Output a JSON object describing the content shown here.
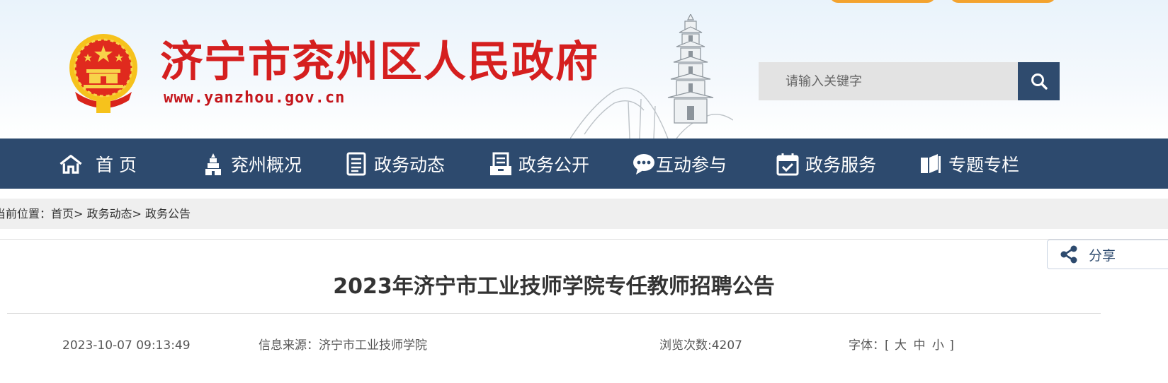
{
  "header": {
    "site_name": "济宁市兖州区人民政府",
    "site_url": "www.yanzhou.gov.cn",
    "emblem_icon": "national-emblem-icon",
    "decoration_icon": "pagoda-illustration",
    "colors": {
      "title_red": "#d51f1f",
      "tab_orange": "#f3a32f"
    }
  },
  "search": {
    "placeholder": "请输入关键字",
    "value": "",
    "button_icon": "search-icon",
    "button_color": "#2f4b6e"
  },
  "nav": {
    "background": "#2d4a6e",
    "items": [
      {
        "label": "首 页",
        "icon": "home-icon"
      },
      {
        "label": "兖州概况",
        "icon": "building-icon"
      },
      {
        "label": "政务动态",
        "icon": "document-list-icon"
      },
      {
        "label": "政务公开",
        "icon": "open-document-icon"
      },
      {
        "label": "互动参与",
        "icon": "chat-bubble-icon"
      },
      {
        "label": "政务服务",
        "icon": "calendar-check-icon"
      },
      {
        "label": "专题专栏",
        "icon": "book-icon"
      }
    ]
  },
  "breadcrumb": {
    "prefix": "当前位置：",
    "items": [
      "首页",
      "政务动态",
      "政务公告"
    ],
    "separator": ">"
  },
  "share": {
    "label": "分享",
    "icon": "share-icon"
  },
  "article": {
    "title": "2023年济宁市工业技师学院专任教师招聘公告",
    "date": "2023-10-07 09:13:49",
    "source_label": "信息来源：",
    "source": "济宁市工业技师学院",
    "views_label": "浏览次数:",
    "views": "4207",
    "font_label": "字体：",
    "font_open": "[",
    "font_sizes": [
      "大",
      "中",
      "小"
    ],
    "font_close": "]"
  }
}
